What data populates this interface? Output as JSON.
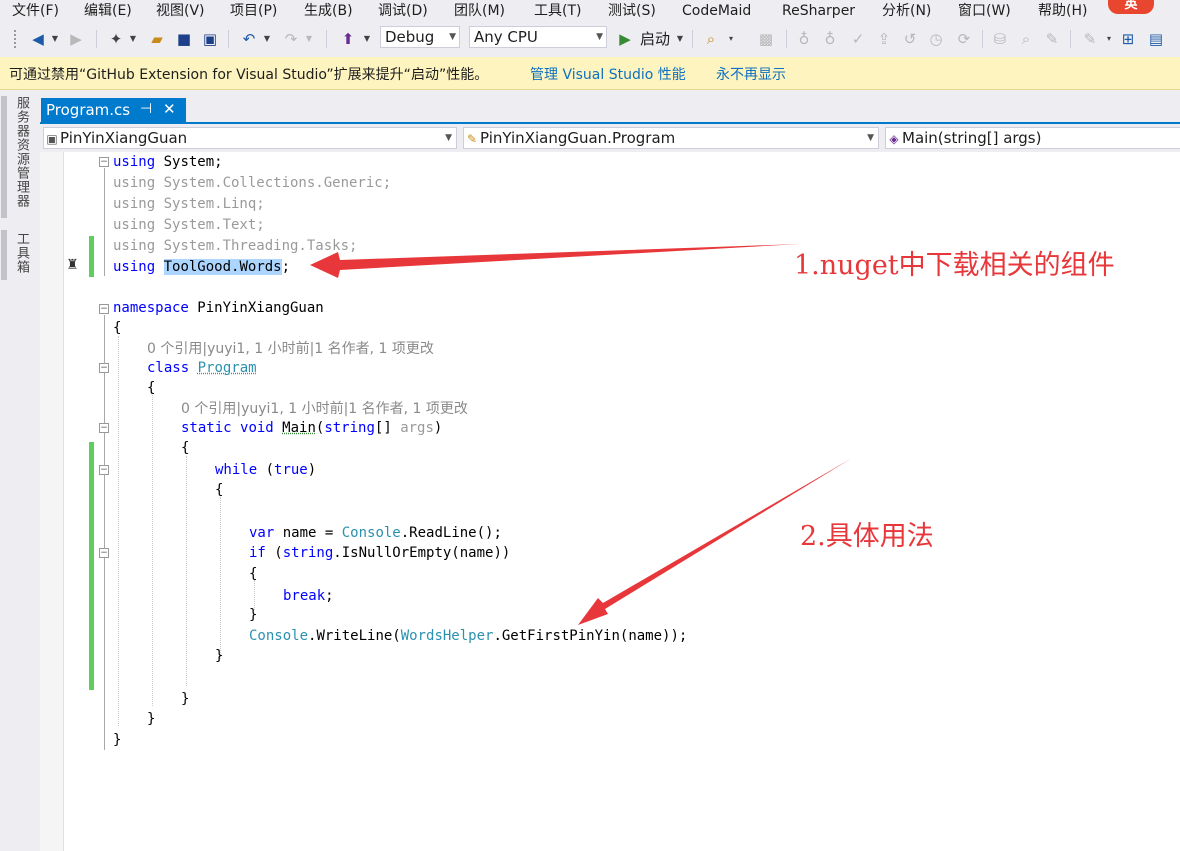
{
  "menu": {
    "items": [
      "文件(F)",
      "编辑(E)",
      "视图(V)",
      "项目(P)",
      "生成(B)",
      "调试(D)",
      "团队(M)",
      "工具(T)",
      "测试(S)",
      "CodeMaid",
      "ReSharper",
      "分析(N)",
      "窗口(W)",
      "帮助(H)"
    ],
    "badge": "英"
  },
  "toolbar": {
    "config": "Debug",
    "platform": "Any CPU",
    "start_label": "启动"
  },
  "infobar": {
    "message": "可通过禁用“GitHub Extension for Visual Studio”扩展来提升“启动”性能。",
    "link_manage": "管理 Visual Studio 性能",
    "link_never": "永不再显示"
  },
  "side_tabs": {
    "server_explorer": "服务器资源管理器",
    "toolbox": "工具箱"
  },
  "document_tab": {
    "title": "Program.cs",
    "pin_icon": "pin-icon",
    "close_icon": "close-icon"
  },
  "navbar": {
    "project": "PinYinXiangGuan",
    "type": "PinYinXiangGuan.Program",
    "member": "Main(string[] args)"
  },
  "code": {
    "l1_kw": "using",
    "l1_rest": " System;",
    "l2": "using System.Collections.Generic;",
    "l3": "using System.Linq;",
    "l4": "using System.Text;",
    "l5": "using System.Threading.Tasks;",
    "l6_kw": "using",
    "l6_ns1": "ToolGood",
    "l6_dot": ".",
    "l6_ns2": "Words",
    "l6_end": ";",
    "l8_kw": "namespace",
    "l8_name": " PinYinXiangGuan",
    "brace_open": "{",
    "brace_close": "}",
    "lens_class": "0 个引用|yuyi1, 1 小时前|1 名作者, 1 项更改",
    "class_kw": "class",
    "class_name": "Program",
    "lens_main": "0 个引用|yuyi1, 1 小时前|1 名作者, 1 项更改",
    "main_kw1": "static",
    "main_kw2": "void",
    "main_name": "Main",
    "main_p1": "(",
    "main_kw3": "string",
    "main_p2": "[] ",
    "main_args": "args",
    "main_p3": ")",
    "while_kw": "while",
    "while_p1": " (",
    "while_kw2": "true",
    "while_p2": ")",
    "var_kw": "var",
    "var_mid": " name = ",
    "var_ty": "Console",
    "var_end": ".ReadLine();",
    "if_kw": "if",
    "if_p1": " (",
    "if_kw2": "string",
    "if_end": ".IsNullOrEmpty(name))",
    "break_kw": "break",
    "break_end": ";",
    "wl_ty1": "Console",
    "wl_mid": ".WriteLine(",
    "wl_ty2": "WordsHelper",
    "wl_end": ".GetFirstPinYin(name));"
  },
  "annotations": {
    "a1": "1.nuget中下载相关的组件",
    "a2": "2.具体用法",
    "arrow_color": "#e8373a"
  }
}
